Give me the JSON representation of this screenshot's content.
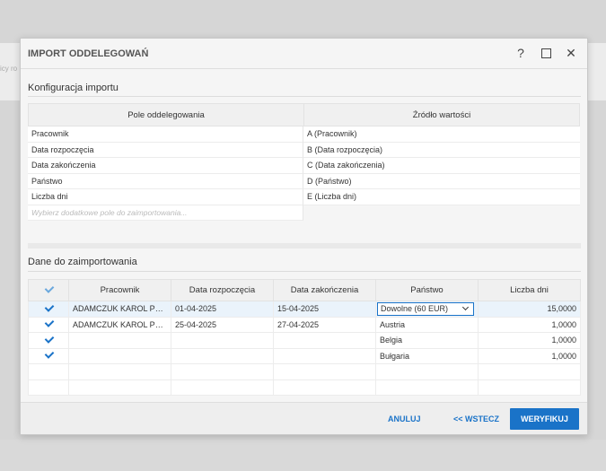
{
  "background": {
    "partial_text": "icy ro"
  },
  "dialog": {
    "title": "IMPORT ODDELEGOWAŃ",
    "help_icon": "?",
    "close_icon": "✕"
  },
  "config": {
    "section_title": "Konfiguracja importu",
    "col_field": "Pole oddelegowania",
    "col_source": "Źródło wartości",
    "rows": [
      {
        "field": "Pracownik",
        "source": "A (Pracownik)"
      },
      {
        "field": "Data rozpoczęcia",
        "source": "B (Data rozpoczęcia)"
      },
      {
        "field": "Data zakończenia",
        "source": "C (Data zakończenia)"
      },
      {
        "field": "Państwo",
        "source": "D (Państwo)"
      },
      {
        "field": "Liczba dni",
        "source": "E (Liczba dni)"
      }
    ],
    "add_placeholder": "Wybierz dodatkowe pole do zaimportowania..."
  },
  "import": {
    "section_title": "Dane do zaimportowania",
    "columns": [
      "Pracownik",
      "Data rozpoczęcia",
      "Data zakończenia",
      "Państwo",
      "Liczba dni"
    ],
    "rows": [
      {
        "checked": true,
        "employee": "ADAMCZUK KAROL PES...",
        "start": "01-04-2025",
        "end": "15-04-2025",
        "country": "Dowolne (60 EUR)",
        "days": "15,0000"
      },
      {
        "checked": true,
        "employee": "ADAMCZUK KAROL PES...",
        "start": "25-04-2025",
        "end": "27-04-2025",
        "country": "Austria",
        "days": "1,0000"
      },
      {
        "checked": true,
        "employee": "",
        "start": "",
        "end": "",
        "country": "Belgia",
        "days": "1,0000"
      },
      {
        "checked": true,
        "employee": "",
        "start": "",
        "end": "",
        "country": "Bułgaria",
        "days": "1,0000"
      }
    ]
  },
  "footer": {
    "cancel": "ANULUJ",
    "back": "<< WSTECZ",
    "verify": "WERYFIKUJ"
  },
  "colors": {
    "accent": "#1a73c8",
    "selected_row": "#eaf3fb"
  }
}
